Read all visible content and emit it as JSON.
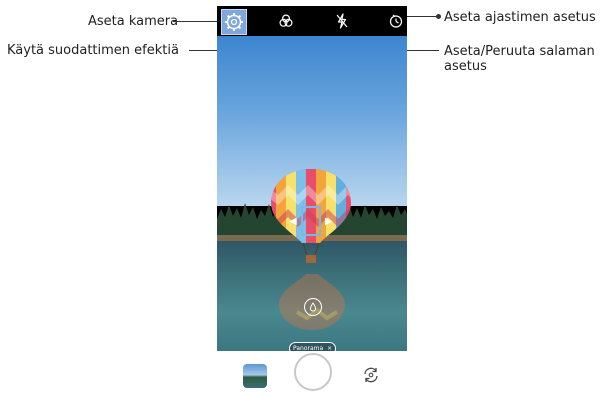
{
  "callouts": {
    "settings": "Aseta kamera",
    "filter": "Käytä suodattimen efektiä",
    "timer": "Aseta ajastimen asetus",
    "flash_line1": "Aseta/Peruuta salaman",
    "flash_line2": "asetus"
  },
  "camera": {
    "mode_chip": "Panorama",
    "mode_chip_close": "×",
    "pan_left": "◀",
    "pan_right": "▶"
  },
  "colors": {
    "accent": "#7fa7d9",
    "line": "#333333"
  },
  "icons": [
    "settings-icon",
    "filter-icon",
    "flash-off-icon",
    "timer-icon",
    "gallery-thumbnail",
    "shutter-button",
    "switch-camera-icon"
  ]
}
